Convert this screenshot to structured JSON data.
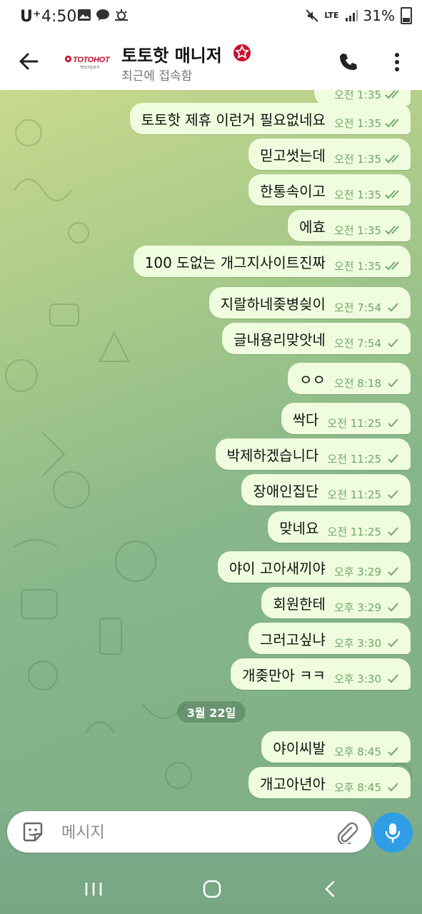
{
  "status_bar": {
    "carrier": "U⁺",
    "time": "4:50",
    "battery": "31%",
    "network": "LTE"
  },
  "header": {
    "title": "토토핫 매니저",
    "subtitle": "최근에 접속함",
    "logo_text": "TOTOHOT",
    "logo_sub": "백테크놀로지"
  },
  "messages": [
    {
      "text": "",
      "time": "오전 1:35",
      "read": true,
      "partial": true
    },
    {
      "text": "토토핫 제휴 이런거 필요없네요",
      "time": "오전 1:35",
      "read": true
    },
    {
      "text": "믿고썻는데",
      "time": "오전 1:35",
      "read": true
    },
    {
      "text": "한통속이고",
      "time": "오전 1:35",
      "read": true
    },
    {
      "text": "에효",
      "time": "오전 1:35",
      "read": true
    },
    {
      "text": "100 도없는 개그지사이트진짜",
      "time": "오전 1:35",
      "read": true
    },
    {
      "text": "지랄하네좆병싖이",
      "time": "오전 7:54",
      "read": false
    },
    {
      "text": "글내용리맞앗네",
      "time": "오전 7:54",
      "read": false
    },
    {
      "text": "ㅇㅇ",
      "time": "오전 8:18",
      "read": false
    },
    {
      "text": "싹다",
      "time": "오전 11:25",
      "read": false
    },
    {
      "text": "박제하겠습니다",
      "time": "오전 11:25",
      "read": false
    },
    {
      "text": "장애인집단",
      "time": "오전 11:25",
      "read": false
    },
    {
      "text": "맞네요",
      "time": "오전 11:25",
      "read": false
    },
    {
      "text": "야이 고아새끼야",
      "time": "오후 3:29",
      "read": false
    },
    {
      "text": "회원한테",
      "time": "오후 3:29",
      "read": false
    },
    {
      "text": "그러고싶냐",
      "time": "오후 3:30",
      "read": false
    },
    {
      "text": "개좆만아 ㅋㅋ",
      "time": "오후 3:30",
      "read": false
    },
    {
      "text": "야이씨발",
      "time": "오후 8:45",
      "read": false
    },
    {
      "text": "개고아년아",
      "time": "오후 8:45",
      "read": false
    }
  ],
  "date_separator": "3월 22일",
  "composer": {
    "placeholder": "메시지"
  },
  "colors": {
    "bubble": "#effdde",
    "meta": "#6fa76a",
    "accent": "#2f9ee6",
    "brand": "#c8102e"
  },
  "icons": {
    "back": "arrow-left-icon",
    "call": "phone-icon",
    "more": "more-vert-icon",
    "sticker": "sticker-icon",
    "attach": "paperclip-icon",
    "mic": "microphone-icon"
  }
}
